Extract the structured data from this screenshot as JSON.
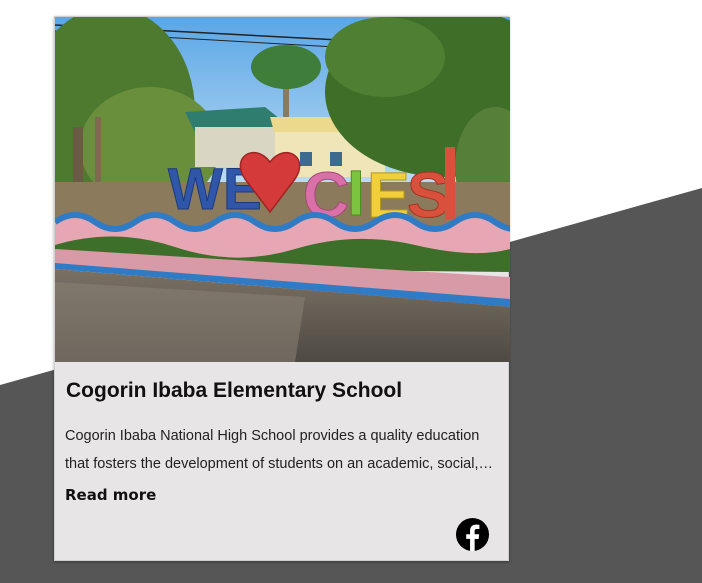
{
  "card": {
    "title": "Cogorin Ibaba Elementary School",
    "description": "Cogorin Ibaba National High School provides a quality education that fosters the development of students on an academic, social, and personal level.",
    "read_more_label": "Read more",
    "sign_text": "WE CIES!",
    "social_icon": "facebook-icon"
  },
  "colors": {
    "card_background": "#e7e5e6",
    "page_background": "#ffffff",
    "diagonal_band": "#565656"
  }
}
